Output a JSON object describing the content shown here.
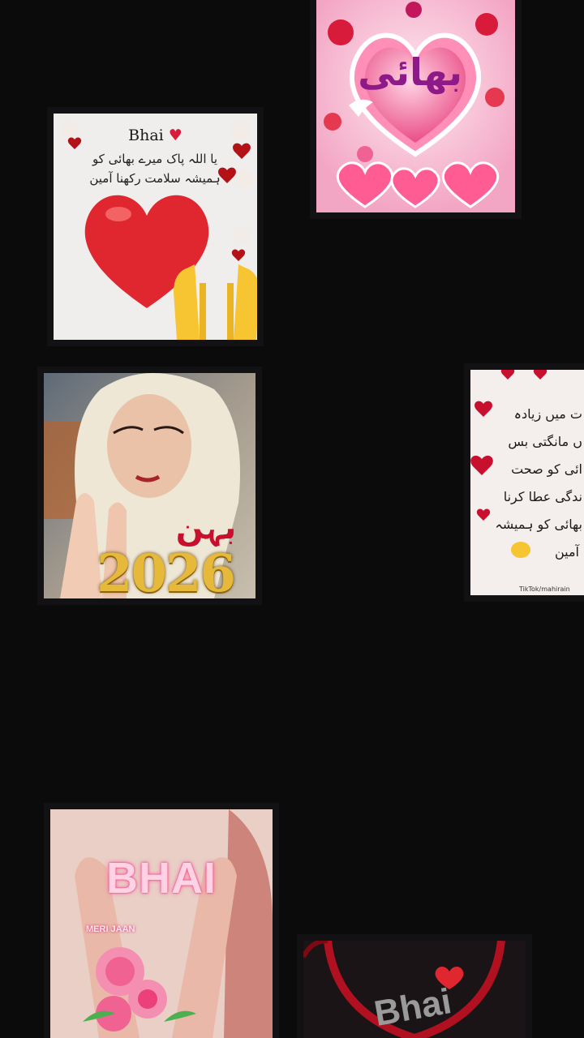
{
  "feed": {
    "cards": [
      {
        "id": "card1",
        "caption": "بھائی"
      },
      {
        "id": "card2",
        "title": "Bhai",
        "line1": "یا اللہ پاک میرے بھائی کو",
        "line2": "ہمیشہ سلامت رکھنا آمین"
      },
      {
        "id": "card3",
        "caption": "بہن",
        "year": "2026"
      },
      {
        "id": "card4",
        "lines": [
          "ت میں زیادہ",
          "ں مانگتی بس",
          "ائی کو صحت",
          "ندگی عطا کرنا",
          "بھائی کو ہمیشہ",
          "آمین"
        ],
        "watermark": "TikTok/mahirain"
      },
      {
        "id": "card5",
        "title": "BHAI",
        "subtitle": "MERI JAAN"
      },
      {
        "id": "card6",
        "title": "Bhai"
      }
    ]
  },
  "colors": {
    "background": "#0b0b0c",
    "heart_red": "#e0262f",
    "pink": "#f06292",
    "gold": "#e6b93a"
  },
  "icons": [
    "heart-icon",
    "praying-hands-icon",
    "rose-icon",
    "dove-icon"
  ]
}
